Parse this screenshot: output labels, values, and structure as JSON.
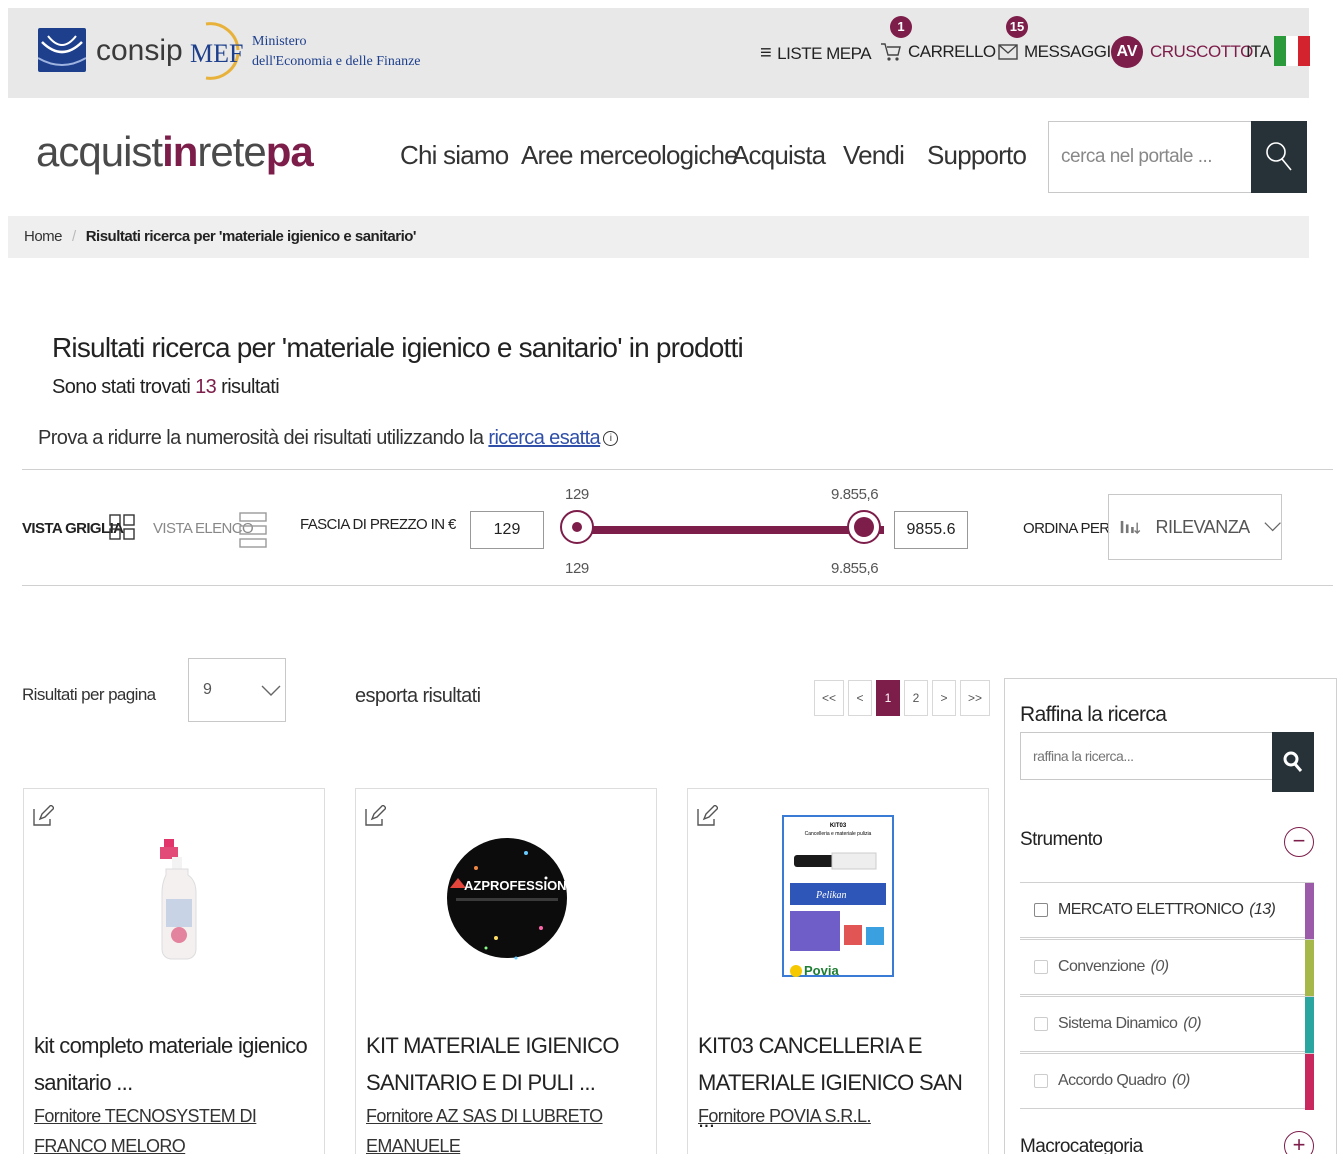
{
  "topbar": {
    "consip_name": "consip",
    "mef_abbr": "MEF",
    "mef_line1": "Ministero",
    "mef_line2": "dell'Economia e delle Finanze",
    "liste_mepa": "LISTE MEPA",
    "carrello": "CARRELLO",
    "carrello_badge": "1",
    "messaggi": "MESSAGGI",
    "messaggi_badge": "15",
    "avatar_initials": "AV",
    "cruscotto": "CRUSCOTTO",
    "language": "ITA",
    "flag_colors": [
      "#2a9a3a",
      "#ffffff",
      "#d3232e"
    ]
  },
  "header": {
    "brand_part1": "acquist",
    "brand_part2": "in",
    "brand_part3": "rete",
    "brand_part4": "pa",
    "nav": [
      "Chi siamo",
      "Aree merceologiche",
      "Acquista",
      "Vendi",
      "Supporto"
    ],
    "search_placeholder": "cerca nel portale ..."
  },
  "breadcrumb": {
    "home": "Home",
    "current": "Risultati ricerca per 'materiale igienico e sanitario'"
  },
  "results": {
    "title": "Risultati ricerca per 'materiale igienico e sanitario' in prodotti",
    "count_prefix": "Sono stati trovati",
    "count": "13",
    "count_suffix": "risultati",
    "hint_text": "Prova a ridurre la numerosità dei risultati utilizzando la",
    "hint_link": "ricerca esatta"
  },
  "filters": {
    "view_grid": "VISTA GRIGLIA",
    "view_list": "VISTA ELENCO",
    "price_label": "FASCIA DI PREZZO IN €",
    "price_min": "129",
    "price_max": "9855.6",
    "slider_min_label": "129",
    "slider_max_label": "9.855,6",
    "sort_label": "ORDINA PER",
    "sort_value": "RILEVANZA"
  },
  "controls": {
    "rpp_label": "Risultati per pagina",
    "rpp_value": "9",
    "export": "esporta risultati",
    "pager": [
      "<<",
      "<",
      "1",
      "2",
      ">",
      ">>"
    ],
    "current_page": "1"
  },
  "products": [
    {
      "title": "kit completo materiale igienico sanitario ...",
      "vendor": "Fornitore TECNOSYSTEM DI FRANCO MELORO"
    },
    {
      "title": "KIT MATERIALE IGIENICO SANITARIO E DI PULI ...",
      "vendor": "Fornitore AZ SAS DI LUBRETO EMANUELE",
      "image_text": "AZPROFESSIONAL"
    },
    {
      "title": "KIT03 CANCELLERIA E MATERIALE IGIENICO SAN ...",
      "vendor": "Fornitore POVIA S.R.L.",
      "image_text_1": "KIT03",
      "image_text_2": "Cancelleria e materiale pulizia",
      "image_brand": "Pelikan",
      "image_logo": "Povia"
    }
  ],
  "refine": {
    "title": "Raffina la ricerca",
    "placeholder": "raffina la ricerca...",
    "strumento": "Strumento",
    "facets": [
      {
        "label": "MERCATO ELETTRONICO",
        "count": "(13)",
        "color": "#9c5ba8",
        "enabled": true
      },
      {
        "label": "Convenzione",
        "count": "(0)",
        "color": "#a6b84a",
        "enabled": false
      },
      {
        "label": "Sistema Dinamico",
        "count": "(0)",
        "color": "#2aa5a0",
        "enabled": false
      },
      {
        "label": "Accordo Quadro",
        "count": "(0)",
        "color": "#c9285e",
        "enabled": false
      }
    ],
    "macrocategoria": "Macrocategoria"
  }
}
